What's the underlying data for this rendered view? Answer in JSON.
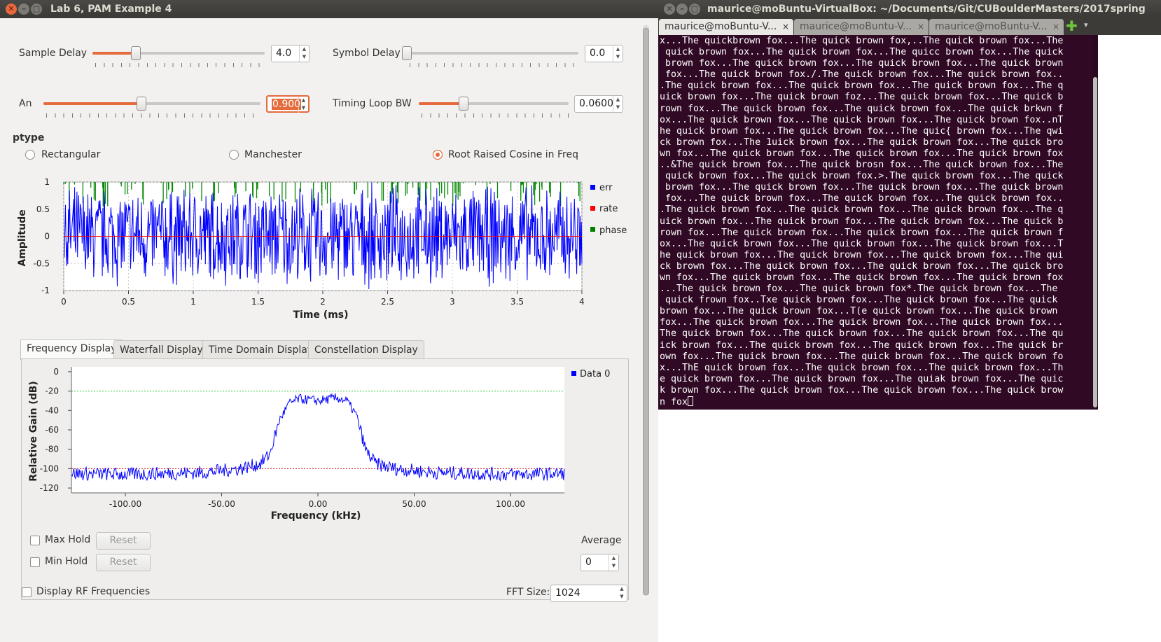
{
  "gui": {
    "title": "Lab 6, PAM Example 4",
    "sample_delay": {
      "label": "Sample Delay",
      "value": "4.0",
      "level": 0.25
    },
    "symbol_delay": {
      "label": "Symbol Delay",
      "value": "0.0",
      "level": 0.0
    },
    "an": {
      "label": "An",
      "value": "0.900",
      "level": 0.45
    },
    "timing_loop_bw": {
      "label": "Timing Loop BW",
      "value": "0.0600",
      "level": 0.3
    },
    "ptype": {
      "label": "ptype",
      "options": [
        "Rectangular",
        "Manchester",
        "Root Raised Cosine in Freq"
      ],
      "selected": "Root Raised Cosine in Freq"
    },
    "tabs": [
      "Frequency Display",
      "Waterfall Display",
      "Time Domain Display",
      "Constellation Display"
    ],
    "active_tab": "Frequency Display",
    "max_hold": {
      "label": "Max Hold",
      "button": "Reset"
    },
    "min_hold": {
      "label": "Min Hold",
      "button": "Reset"
    },
    "average": {
      "label": "Average",
      "value": "0"
    },
    "display_rf": "Display RF Frequencies",
    "fft_size": {
      "label": "FFT Size:",
      "value": "1024"
    }
  },
  "chart_data": [
    {
      "type": "line",
      "title": "",
      "xlabel": "Time (ms)",
      "ylabel": "Amplitude",
      "xlim": [
        0,
        4
      ],
      "ylim": [
        -1,
        1
      ],
      "xticks": [
        "0",
        "0.5",
        "1",
        "1.5",
        "2",
        "2.5",
        "3",
        "3.5",
        "4"
      ],
      "yticks": [
        "1",
        "0.5",
        "0",
        "-0.5",
        "-1"
      ],
      "grid": true,
      "legend_placement": "right",
      "series": [
        {
          "name": "err",
          "color": "#0000ff",
          "description_values": "noise-like, approx. between -1 and 1"
        },
        {
          "name": "rate",
          "color": "#ff0000",
          "values_const": 0.0
        },
        {
          "name": "phase",
          "color": "#008000",
          "description_values": "sparse spikes near top, approx. 0.6 to 1"
        }
      ]
    },
    {
      "type": "line",
      "title": "",
      "xlabel": "Frequency (kHz)",
      "ylabel": "Relative Gain (dB)",
      "xlim": [
        -128,
        128
      ],
      "ylim": [
        -125,
        5
      ],
      "xticks": [
        "-100.00",
        "-50.00",
        "0.00",
        "50.00",
        "100.00"
      ],
      "yticks": [
        "0",
        "-20",
        "-40",
        "-60",
        "-80",
        "-100",
        "-120"
      ],
      "grid": false,
      "legend_placement": "top-right",
      "reference_lines": [
        -20,
        -100
      ],
      "series": [
        {
          "name": "Data 0",
          "color": "#0000ff",
          "x": [
            -128,
            -100,
            -60,
            -40,
            -30,
            -25,
            -20,
            -15,
            -10,
            0,
            10,
            15,
            20,
            25,
            30,
            40,
            60,
            100,
            128
          ],
          "y": [
            -105,
            -106,
            -104,
            -100,
            -95,
            -85,
            -50,
            -33,
            -28,
            -30,
            -27,
            -30,
            -45,
            -82,
            -95,
            -100,
            -104,
            -106,
            -105
          ]
        }
      ]
    }
  ],
  "terminal": {
    "title": "maurice@moBuntu-VirtualBox: ~/Documents/Git/CUBoulderMasters/2017spring",
    "tabs": [
      "maurice@moBuntu-V...",
      "maurice@moBuntu-V...",
      "maurice@moBuntu-V..."
    ],
    "lines": [
      "x...The quickbrown fox...The quick brown fox,..The quick brown fox...The",
      " quick brown fox...The quick brown fox...The quicc brown fox...The quick",
      " brown fox...The quick brown fox...The quick brown fox...The quick brown",
      " fox...The quick brown fox./.The quick brown fox...The quick brown fox..",
      ".The quick brown fox...The quick brown fox...The quick brown fox...The q",
      "uick brown fox...The quick brown foz...The quick brown fox...The quick b",
      "rown fox...The quick brown fox...The quick brown fox...The quick brkwn f",
      "ox...The quick brown fox...The quick brown fox...The quick brown fox..nT",
      "he quick brown fox...The quick brown fox...The quic{ brown fox...The qwi",
      "ck brown fox...The 1uick brown fox...The quick brown fox...The quick bro",
      "wn fox...The quick brown fox...The quick brown fox...The quick brown fox",
      "..&The quick brown fox...The quick brosn fox...The quick brown fox...The",
      " quick brown fox...The quick brown fox.>.The quick brown fox...The quick",
      " brown fox...The quick brown fox...The quick brown fox...The quick brown",
      " fox...The quick brown fox...The quick brown fox...The quick brown fox..",
      ".The quick brown fox...The quick brown fox...The quick brown fox...The q",
      "uick brown fox...The quick brown fox...The quick brown fox...The quick b",
      "rown fox...The quick brown fox...The quick brown fox...The quick brown f",
      "ox...The quick brown fox...The quick brown fox...The quick brown fox...T",
      "he quick brown fox...The quick brown fox...The quick brown fox...The qui",
      "ck brown fox...The quick brown fox...The quick brown fox...The quick bro",
      "wn fox...The quick brown fox...The quick brown fox...The quick brown fox",
      "...The quick brown fox...The quick brown fox*.The quick brown fox...The",
      " quick frown fox..Txe quick brown fox...The quick brown fox...The quick",
      "brown fox...The quick brown fox...T(e quick brown fox...The quick brown",
      "fox...The quick brown fox...The quick brown fox...The quick brown fox...",
      "The quick brown fox...The quick brown fox...The quick brown fox...The qu",
      "ick brown fox...The quick brown fox...The quick brown fox...The quick br",
      "own fox...The quick brown fox...The quick brown fox...The quick brown fo",
      "x...ThE quick brown fox...The quick brown fox...The quick brown fox...Th",
      "e quick brown fox...The quick brown fox...The quiak brown fox...The quic",
      "k brown fox...The quick brown fox...The quick brown fox...The quick brow",
      "n fox"
    ]
  }
}
